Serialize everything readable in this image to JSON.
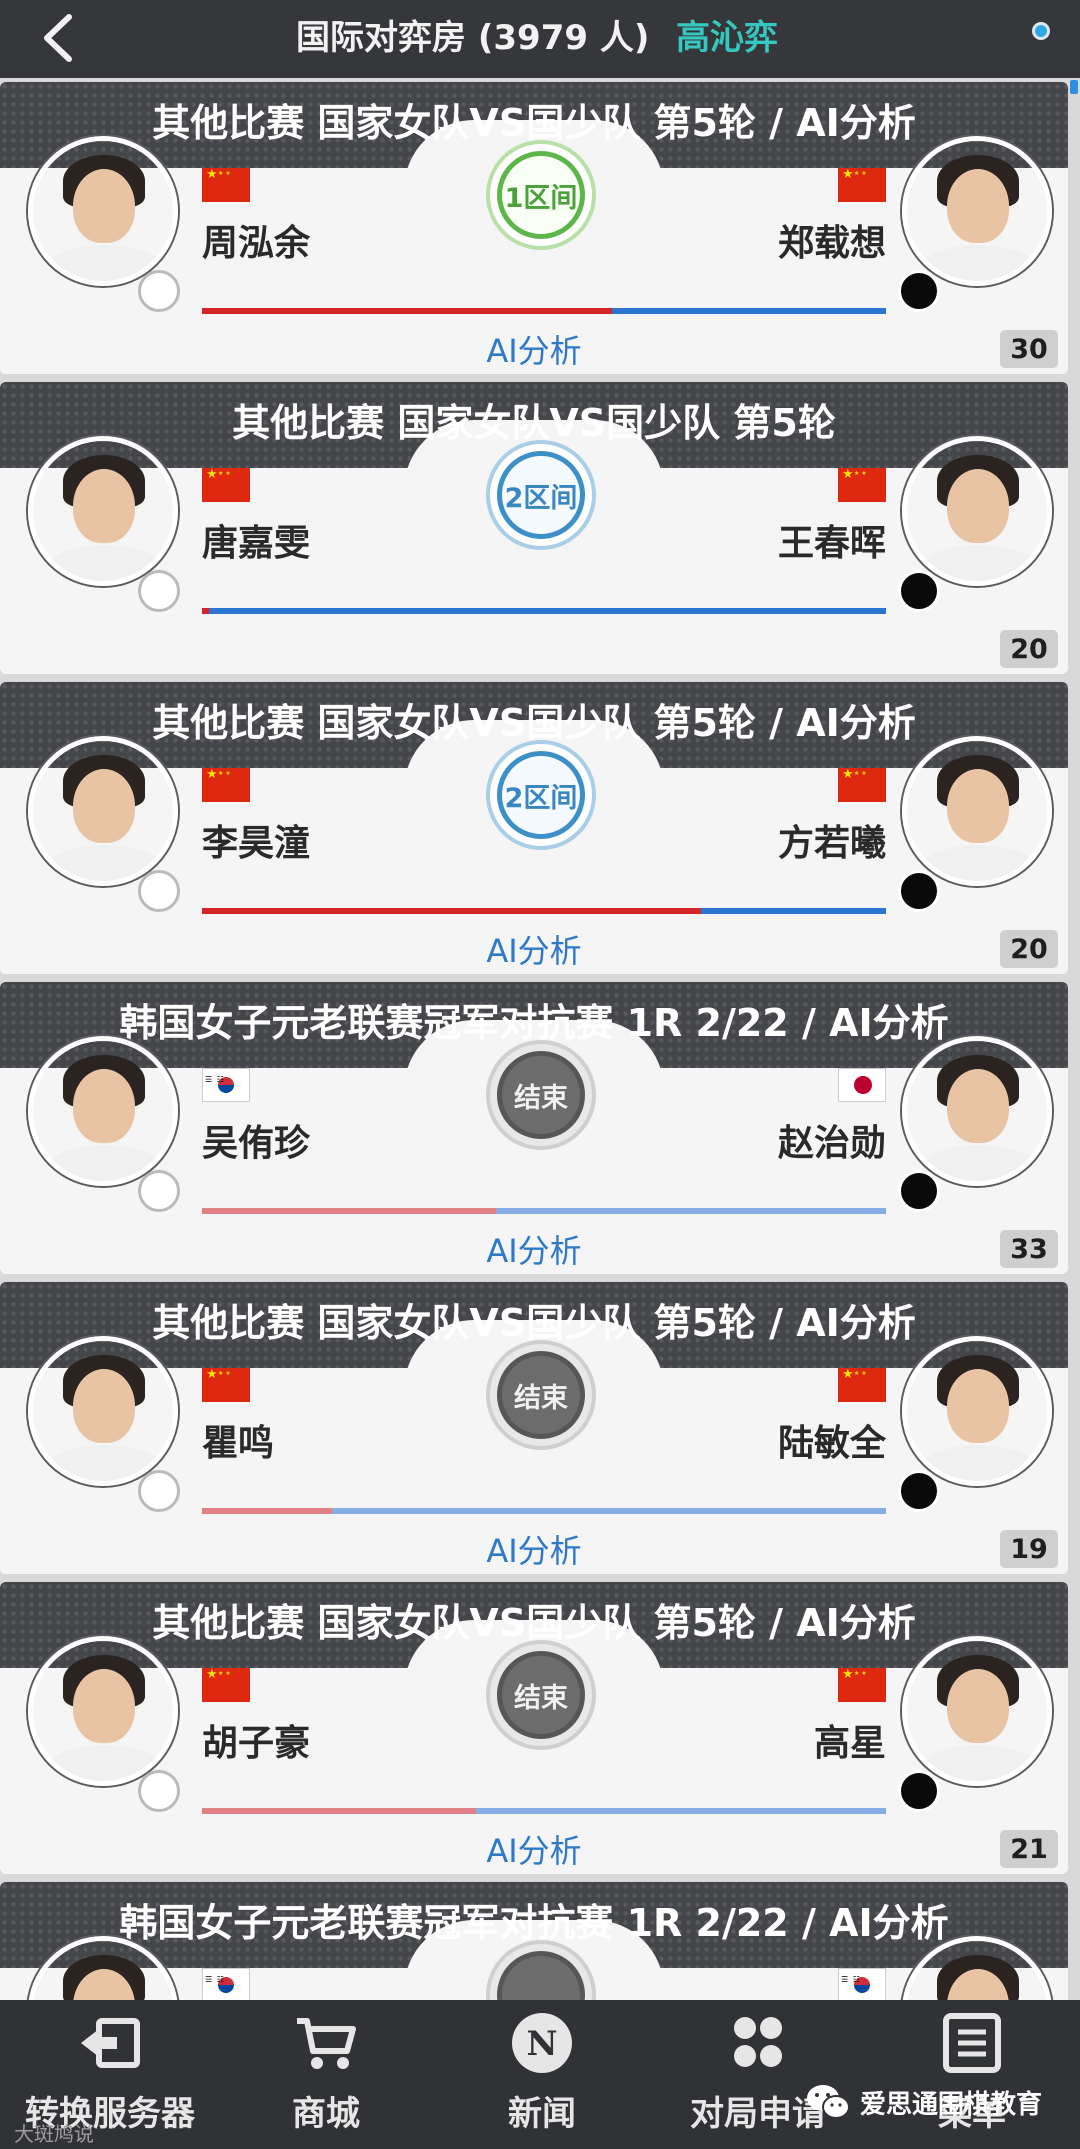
{
  "header": {
    "room_title": "国际对弈房 (3979 人)",
    "user_name": "高沁弈"
  },
  "games": [
    {
      "title": "其他比赛  国家女队VS国少队  第5轮 / AI分析",
      "left_flag": "cn",
      "right_flag": "cn",
      "left_player": "周泓余",
      "right_player": "郑载想",
      "badge": "1区间",
      "badge_style": "green",
      "red_ratio": 0.6,
      "bar_faded": false,
      "ai_label": "AI分析",
      "count": "30"
    },
    {
      "title": "其他比赛  国家女队VS国少队  第5轮",
      "left_flag": "cn",
      "right_flag": "cn",
      "left_player": "唐嘉雯",
      "right_player": "王春晖",
      "badge": "2区间",
      "badge_style": "blue",
      "red_ratio": 0.01,
      "bar_faded": false,
      "ai_label": "",
      "count": "20"
    },
    {
      "title": "其他比赛  国家女队VS国少队  第5轮 / AI分析",
      "left_flag": "cn",
      "right_flag": "cn",
      "left_player": "李昊潼",
      "right_player": "方若曦",
      "badge": "2区间",
      "badge_style": "blue",
      "red_ratio": 0.73,
      "bar_faded": false,
      "ai_label": "AI分析",
      "count": "20"
    },
    {
      "title": "韩国女子元老联赛冠军对抗赛  1R 2/22 / AI分析",
      "left_flag": "kr",
      "right_flag": "jp",
      "left_player": "吴侑珍",
      "right_player": "赵治勋",
      "badge": "结束",
      "badge_style": "gray",
      "red_ratio": 0.43,
      "bar_faded": true,
      "ai_label": "AI分析",
      "count": "33"
    },
    {
      "title": "其他比赛  国家女队VS国少队  第5轮 / AI分析",
      "left_flag": "cn",
      "right_flag": "cn",
      "left_player": "瞿鸣",
      "right_player": "陆敏全",
      "badge": "结束",
      "badge_style": "gray",
      "red_ratio": 0.19,
      "bar_faded": true,
      "ai_label": "AI分析",
      "count": "19"
    },
    {
      "title": "其他比赛  国家女队VS国少队  第5轮 / AI分析",
      "left_flag": "cn",
      "right_flag": "cn",
      "left_player": "胡子豪",
      "right_player": "高星",
      "badge": "结束",
      "badge_style": "gray",
      "red_ratio": 0.4,
      "bar_faded": true,
      "ai_label": "AI分析",
      "count": "21"
    },
    {
      "title": "韩国女子元老联赛冠军对抗赛  1R 2/22 / AI分析",
      "left_flag": "kr",
      "right_flag": "kr",
      "left_player": "",
      "right_player": "",
      "badge": "",
      "badge_style": "gray",
      "red_ratio": 0.5,
      "bar_faded": true,
      "ai_label": "",
      "count": ""
    }
  ],
  "bottom_nav": [
    {
      "label": "转换服务器",
      "icon": "switch-server-icon"
    },
    {
      "label": "商城",
      "icon": "cart-icon"
    },
    {
      "label": "新闻",
      "icon": "news-icon"
    },
    {
      "label": "对局申请",
      "icon": "game-request-icon"
    },
    {
      "label": "菜单",
      "icon": "menu-icon"
    }
  ],
  "watermark": {
    "text": "爱思通围棋教育",
    "small": "大斑鸠说"
  },
  "colors": {
    "accent": "#35c8c0",
    "link": "#2e78c9",
    "black_bar": "#2b74d0",
    "red_bar": "#d6252a"
  }
}
